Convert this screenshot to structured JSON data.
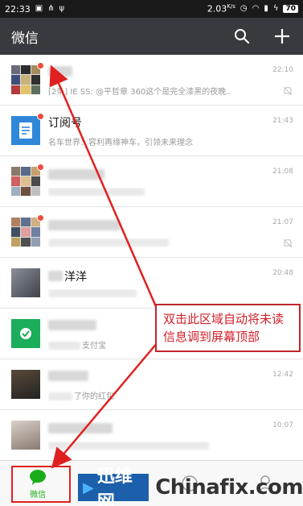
{
  "status_bar": {
    "time": "22:33",
    "speed": "2.03",
    "speed_unit": "K/s",
    "battery": "70"
  },
  "app_bar": {
    "title": "微信",
    "search_icon": "search-icon",
    "add_icon": "plus-icon"
  },
  "chats": [
    {
      "name": "",
      "msg_prefix": "[2条] IE  SS: @平哲章 360这个是完全漆黑的夜晚..",
      "time": "22:10",
      "unread": true,
      "muted": true,
      "avatar": "group"
    },
    {
      "name": "订阅号",
      "msg_prefix": "名车世界：容利再缘神车，引领未来理念",
      "time": "21:43",
      "unread": true,
      "muted": false,
      "avatar": "blue"
    },
    {
      "name": "",
      "msg_prefix": "",
      "time": "21:08",
      "unread": true,
      "muted": false,
      "avatar": "group"
    },
    {
      "name": "",
      "msg_prefix": "",
      "time": "21:07",
      "unread": true,
      "muted": true,
      "avatar": "group"
    },
    {
      "name": "洋洋",
      "msg_prefix": "",
      "time": "20:48",
      "unread": false,
      "muted": false,
      "avatar": "photo"
    },
    {
      "name": "",
      "msg_prefix": "支付宝",
      "time": "",
      "unread": false,
      "muted": false,
      "avatar": "green"
    },
    {
      "name": "",
      "msg_prefix": "了你的红包",
      "time": "12:42",
      "unread": false,
      "muted": false,
      "avatar": "photo2"
    },
    {
      "name": "",
      "msg_prefix": "",
      "time": "10:07",
      "unread": false,
      "muted": false,
      "avatar": "photo3"
    }
  ],
  "callout": {
    "line1": "双击此区域自动将未读",
    "line2": "信息调到屏幕顶部"
  },
  "bottom_nav": {
    "items": [
      {
        "label": "微信",
        "icon": "chat-bubble-icon",
        "active": true
      },
      {
        "label": "",
        "icon": "contacts-icon",
        "active": false
      },
      {
        "label": "",
        "icon": "discover-icon",
        "active": false
      },
      {
        "label": "",
        "icon": "me-icon",
        "active": false
      }
    ]
  },
  "watermark": {
    "brand_cn": "迅维网",
    "brand_en": "Chinafix.com"
  },
  "colors": {
    "app_bar": "#393a3f",
    "unread_dot": "#f24a3f",
    "callout_red": "#d0202a",
    "active_green": "#1aad19"
  }
}
